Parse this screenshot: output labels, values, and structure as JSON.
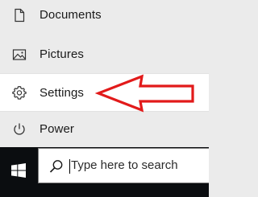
{
  "start_menu": {
    "items": [
      {
        "label": "Documents",
        "icon": "document-icon"
      },
      {
        "label": "Pictures",
        "icon": "pictures-icon"
      },
      {
        "label": "Settings",
        "icon": "gear-icon"
      },
      {
        "label": "Power",
        "icon": "power-icon"
      }
    ]
  },
  "taskbar": {
    "start_icon": "windows-logo-icon",
    "search": {
      "placeholder": "Type here to search",
      "icon": "search-icon"
    }
  },
  "annotation": {
    "arrow_color": "#e21a1a",
    "points_to": "Settings"
  },
  "colors": {
    "menu_background": "#ebebeb",
    "highlight_background": "#ffffff",
    "taskbar_background": "#0b0d10",
    "text": "#1a1a1a"
  }
}
